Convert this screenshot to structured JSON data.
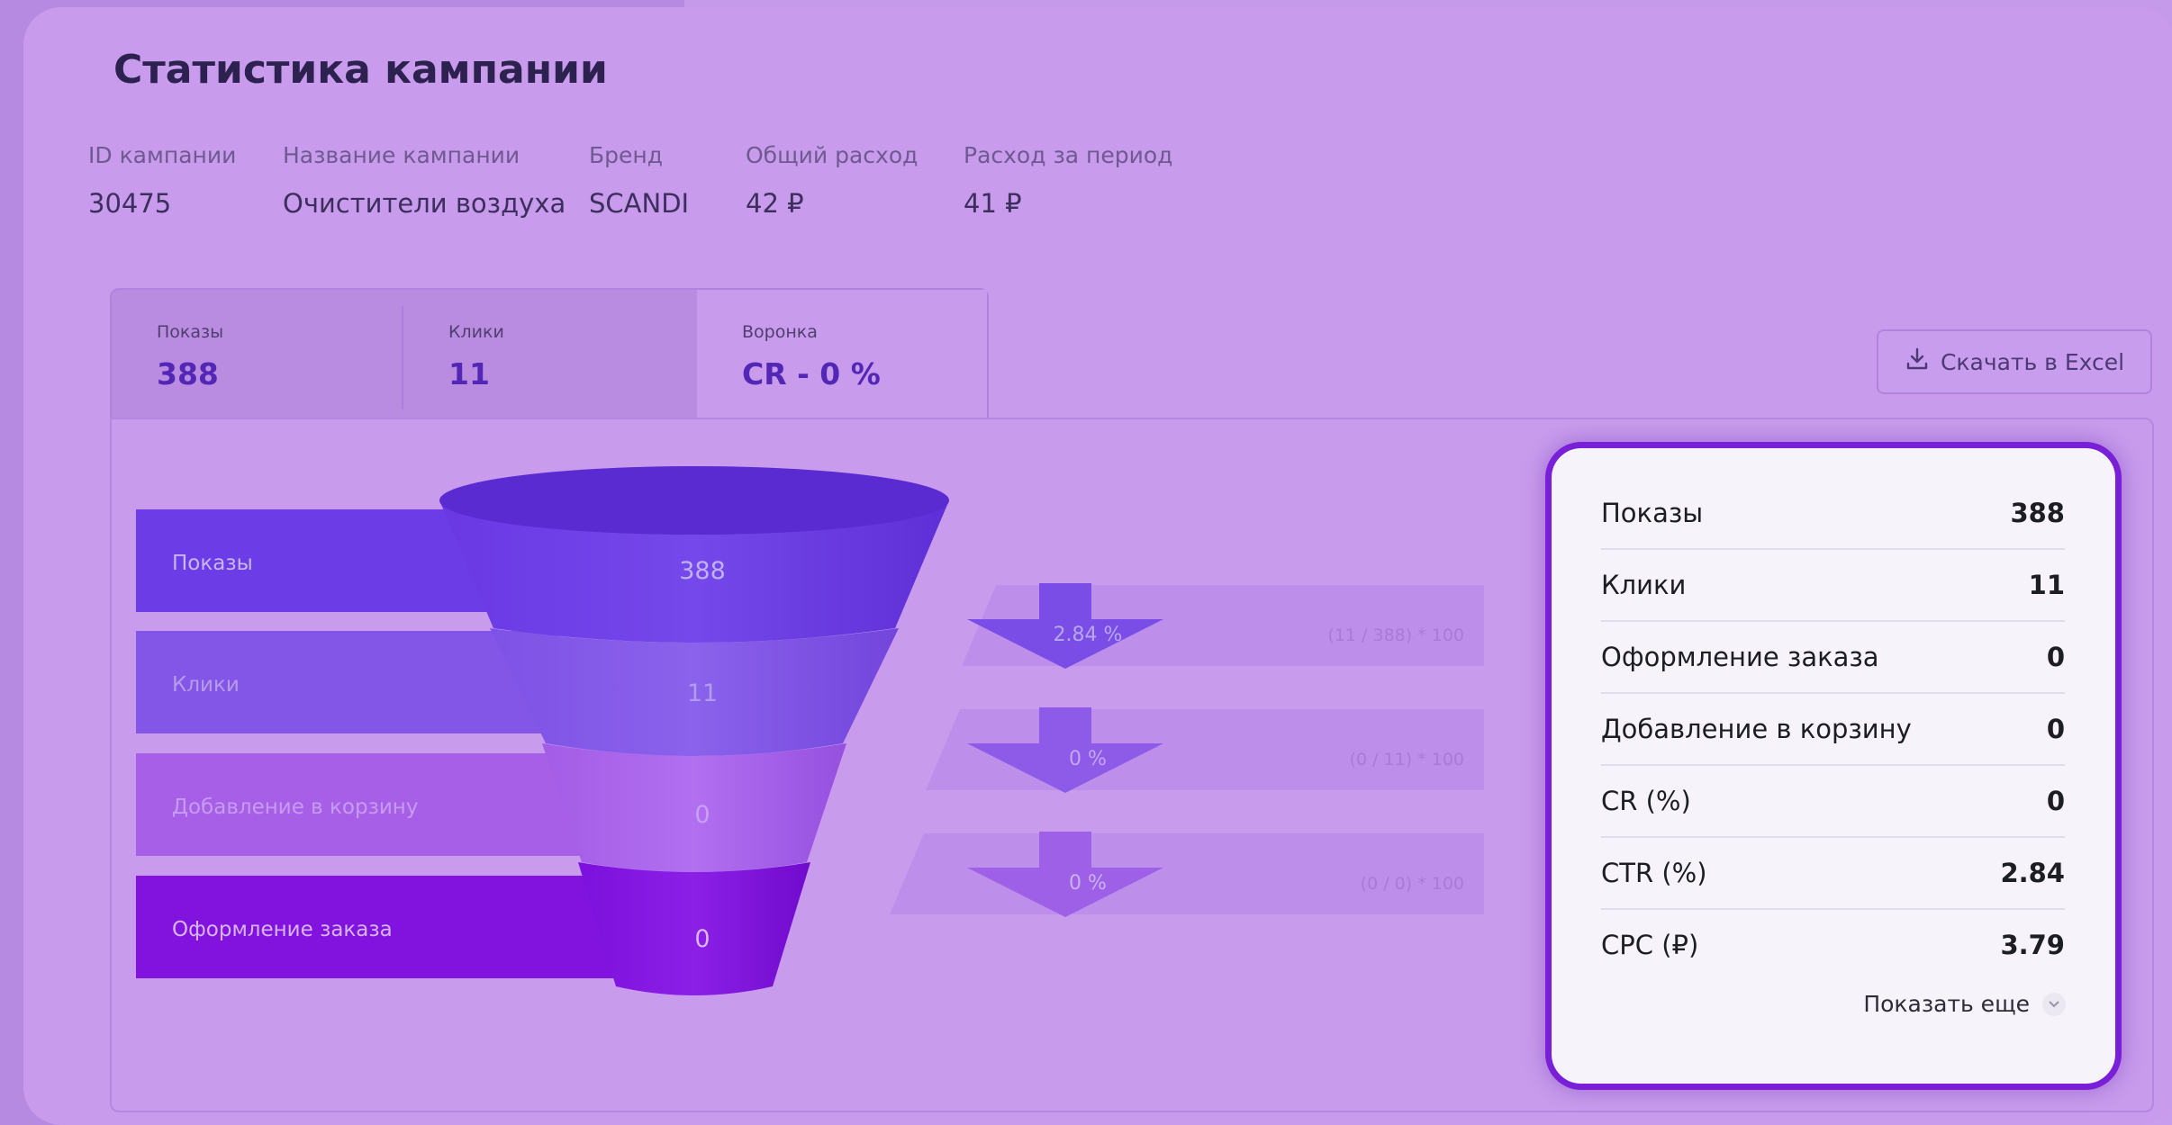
{
  "page": {
    "title": "Статистика кампании"
  },
  "meta": [
    {
      "label": "ID кампании",
      "value": "30475"
    },
    {
      "label": "Название кампании",
      "value": "Очистители воздуха"
    },
    {
      "label": "Бренд",
      "value": "SCANDI"
    },
    {
      "label": "Общий расход",
      "value": "42 ₽"
    },
    {
      "label": "Расход за период",
      "value": "41 ₽"
    }
  ],
  "tabs": [
    {
      "label": "Показы",
      "value": "388"
    },
    {
      "label": "Клики",
      "value": "11"
    },
    {
      "label": "Воронка",
      "value": "CR - 0 %"
    }
  ],
  "active_tab": "Воронка",
  "download_button": {
    "label": "Скачать в Excel",
    "icon": "download-icon"
  },
  "funnel": {
    "stages": [
      {
        "label": "Показы",
        "value": "388",
        "color": "#6c3ce6"
      },
      {
        "label": "Клики",
        "value": "11",
        "color": "#8356e8"
      },
      {
        "label": "Добавление в корзину",
        "value": "0",
        "color": "#a85fe8"
      },
      {
        "label": "Оформление заказа",
        "value": "0",
        "color": "#8213df"
      }
    ],
    "conversions": [
      {
        "percent": "2.84 %",
        "formula": "(11 / 388) * 100"
      },
      {
        "percent": "0 %",
        "formula": "(0 / 11) * 100"
      },
      {
        "percent": "0 %",
        "formula": "(0 / 0) * 100"
      }
    ]
  },
  "popup": {
    "rows": [
      {
        "label": "Показы",
        "value": "388"
      },
      {
        "label": "Клики",
        "value": "11"
      },
      {
        "label": "Оформление заказа",
        "value": "0"
      },
      {
        "label": "Добавление в корзину",
        "value": "0"
      },
      {
        "label": "CR (%)",
        "value": "0"
      },
      {
        "label": "CTR (%)",
        "value": "2.84"
      },
      {
        "label": "CPC (₽)",
        "value": "3.79"
      }
    ],
    "show_more_label": "Показать еще",
    "accent_color": "#7a1fd8"
  }
}
